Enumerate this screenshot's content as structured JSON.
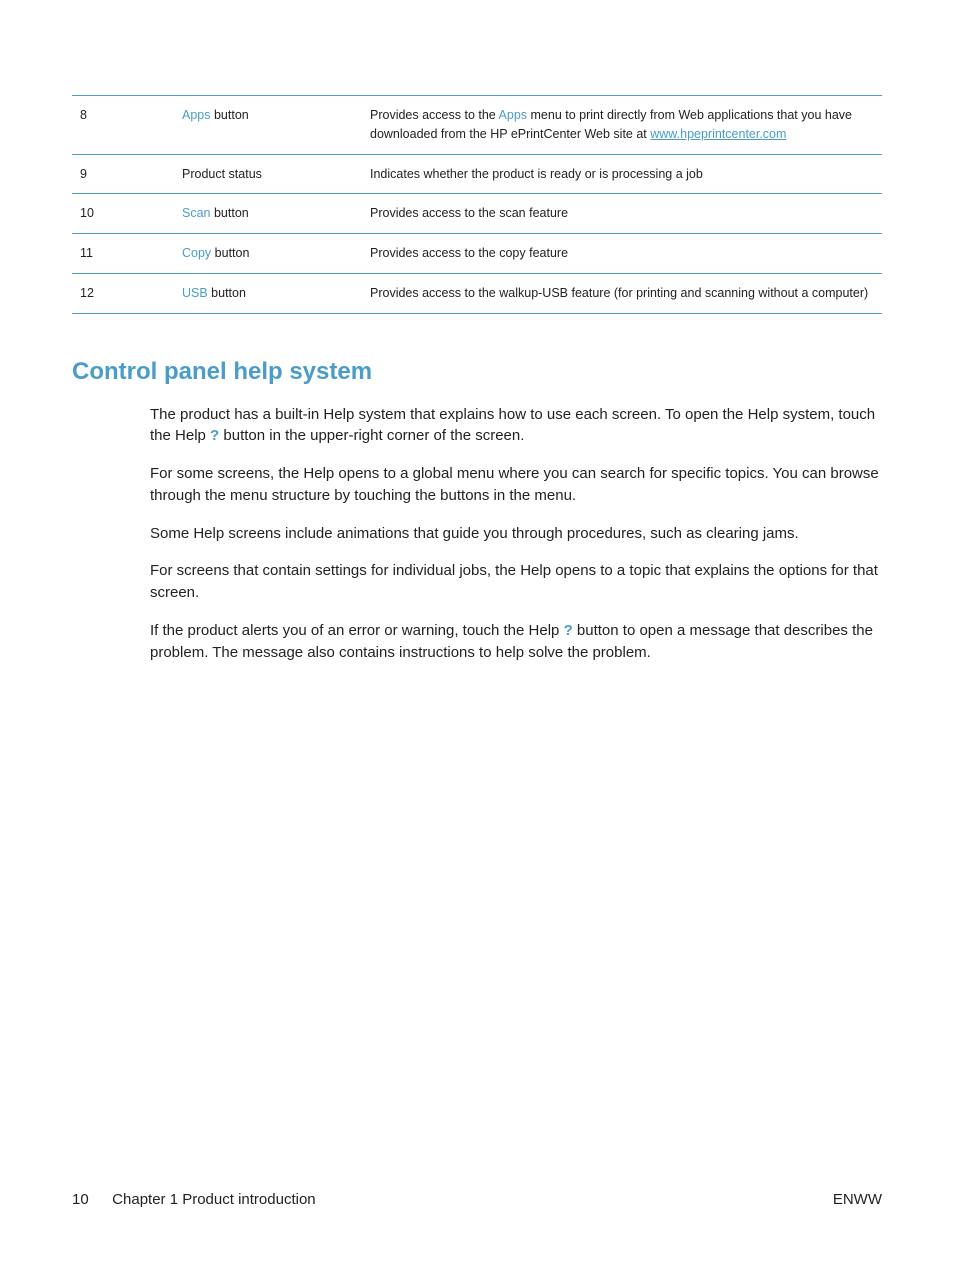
{
  "table": {
    "rows": [
      {
        "num": "8",
        "label_link": "Apps",
        "label_suffix": " button",
        "desc_prefix": "Provides access to the ",
        "desc_link": "Apps",
        "desc_mid": " menu to print directly from Web applications that you have downloaded from the HP ePrintCenter Web site at ",
        "desc_url": "www.hpeprintcenter.com",
        "desc_suffix": ""
      },
      {
        "num": "9",
        "label_plain": "Product status",
        "desc_plain": "Indicates whether the product is ready or is processing a job"
      },
      {
        "num": "10",
        "label_link": "Scan",
        "label_suffix": " button",
        "desc_plain": "Provides access to the scan feature"
      },
      {
        "num": "11",
        "label_link": "Copy",
        "label_suffix": " button",
        "desc_plain": "Provides access to the copy feature"
      },
      {
        "num": "12",
        "label_link": "USB",
        "label_suffix": " button",
        "desc_plain": "Provides access to the walkup-USB feature (for printing and scanning without a computer)"
      }
    ]
  },
  "section_heading": "Control panel help system",
  "paragraphs": {
    "p1a": "The product has a built-in Help system that explains how to use each screen. To open the Help system, touch the Help ",
    "p1b": " button in the upper-right corner of the screen.",
    "p2": "For some screens, the Help opens to a global menu where you can search for specific topics. You can browse through the menu structure by touching the buttons in the menu.",
    "p3": "Some Help screens include animations that guide you through procedures, such as clearing jams.",
    "p4": "For screens that contain settings for individual jobs, the Help opens to a topic that explains the options for that screen.",
    "p5a": "If the product alerts you of an error or warning, touch the Help ",
    "p5b": " button to open a message that describes the problem. The message also contains instructions to help solve the problem."
  },
  "help_glyph": "?",
  "footer": {
    "page_number": "10",
    "chapter": "Chapter 1   Product introduction",
    "lang": "ENWW"
  }
}
